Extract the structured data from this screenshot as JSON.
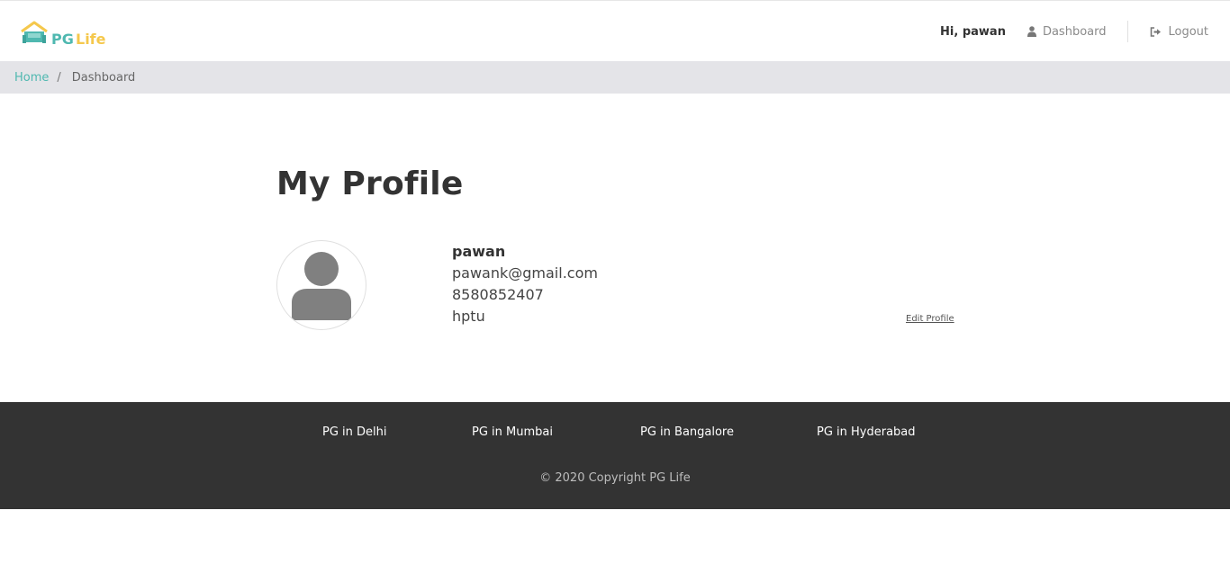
{
  "brand": {
    "logo_text": "PG Life",
    "accent": "#4fb8b0",
    "logo_yellow": "#f5c84c"
  },
  "header": {
    "greeting": "Hi, pawan",
    "dashboard_label": "Dashboard",
    "dashboard_icon": "user-icon",
    "logout_label": "Logout",
    "logout_icon": "sign-out-icon"
  },
  "breadcrumb": {
    "home": "Home",
    "separator": "/",
    "current": "Dashboard"
  },
  "main": {
    "title": "My Profile",
    "avatar_icon": "user-avatar-icon",
    "user": {
      "name": "pawan",
      "email": "pawank@gmail.com",
      "phone": "8580852407",
      "college": "hptu"
    },
    "edit_label": "Edit Profile"
  },
  "footer": {
    "links": [
      "PG in Delhi",
      "PG in Mumbai",
      "PG in Bangalore",
      "PG in Hyderabad"
    ],
    "copyright": "© 2020 Copyright PG Life",
    "background": "#333333"
  }
}
